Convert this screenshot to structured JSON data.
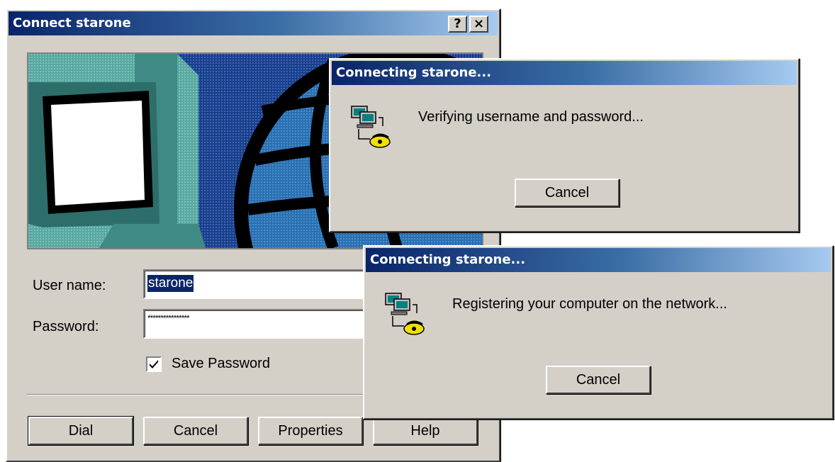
{
  "main_dialog": {
    "title": "Connect starone",
    "help_button": "?",
    "close_button": "×",
    "username_label": "User name:",
    "username_value": "starone",
    "password_label": "Password:",
    "password_value": "****************",
    "save_password_label": "Save Password",
    "save_password_checked": true,
    "buttons": {
      "dial": "Dial",
      "cancel": "Cancel",
      "properties": "Properties",
      "help": "Help"
    }
  },
  "progress_dialog_1": {
    "title": "Connecting starone...",
    "message": "Verifying username and password...",
    "cancel": "Cancel"
  },
  "progress_dialog_2": {
    "title": "Connecting starone...",
    "message": "Registering your computer on the network...",
    "cancel": "Cancel"
  },
  "colors": {
    "title_start": "#0a246a",
    "title_end": "#a6caf0",
    "face": "#d4d0c8",
    "banner_blue": "#0b3d8c"
  }
}
